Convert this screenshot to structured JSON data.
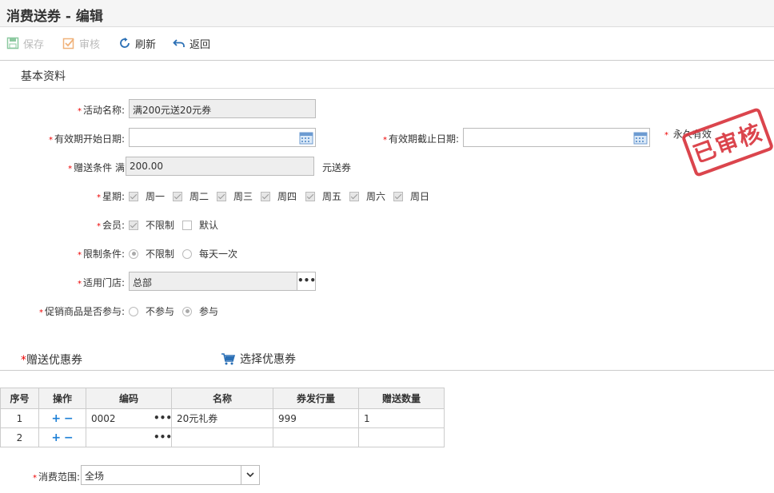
{
  "window": {
    "title": "消费送券 - 编辑"
  },
  "toolbar": {
    "save_label": "保存",
    "audit_label": "审核",
    "refresh_label": "刷新",
    "back_label": "返回"
  },
  "section_basic": {
    "title": "基本资料"
  },
  "form": {
    "activity_name_label": "活动名称:",
    "activity_name_value": "满200元送20元券",
    "start_date_label": "有效期开始日期:",
    "start_date_value": "",
    "end_date_label": "有效期截止日期:",
    "end_date_value": "",
    "permanent_label": "永久有效",
    "condition_label": "赠送条件 满",
    "condition_value": "200.00",
    "condition_suffix": "元送券",
    "weekday_label": "星期:",
    "weekdays": [
      {
        "label": "周一",
        "checked": true
      },
      {
        "label": "周二",
        "checked": true
      },
      {
        "label": "周三",
        "checked": true
      },
      {
        "label": "周四",
        "checked": true
      },
      {
        "label": "周五",
        "checked": true
      },
      {
        "label": "周六",
        "checked": true
      },
      {
        "label": "周日",
        "checked": true
      }
    ],
    "member_label": "会员:",
    "member_options": [
      {
        "label": "不限制",
        "checked": true
      },
      {
        "label": "默认",
        "checked": false
      }
    ],
    "limit_label": "限制条件:",
    "limit_options": [
      {
        "label": "不限制",
        "selected": true
      },
      {
        "label": "每天一次",
        "selected": false
      }
    ],
    "store_label": "适用门店:",
    "store_value": "总部",
    "promo_label": "促销商品是否参与:",
    "promo_options": [
      {
        "label": "不参与",
        "selected": false
      },
      {
        "label": "参与",
        "selected": true
      }
    ]
  },
  "stamp": {
    "text": "已审核"
  },
  "coupon_section": {
    "title": "赠送优惠券",
    "select_label": "选择优惠券"
  },
  "grid": {
    "headers": [
      "序号",
      "操作",
      "编码",
      "名称",
      "券发行量",
      "赠送数量"
    ],
    "rows": [
      {
        "no": "1",
        "code": "0002",
        "name": "20元礼券",
        "issued": "999",
        "qty": "1"
      },
      {
        "no": "2",
        "code": "",
        "name": "",
        "issued": "",
        "qty": ""
      }
    ]
  },
  "scope": {
    "label": "消费范围:",
    "value": "全场"
  },
  "colors": {
    "required": "#e00000",
    "stamp": "#d9363e",
    "accent": "#1c7fd6"
  }
}
